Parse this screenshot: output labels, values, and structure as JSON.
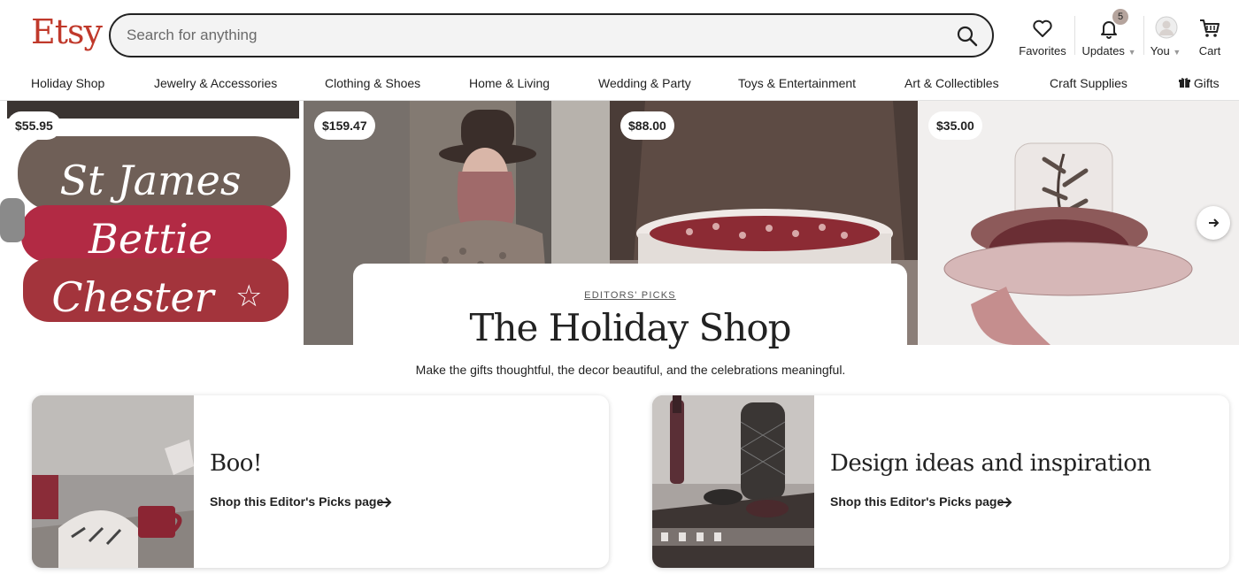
{
  "header": {
    "logo": "Etsy",
    "search_placeholder": "Search for anything",
    "favorites_label": "Favorites",
    "updates_label": "Updates",
    "updates_count": "5",
    "you_label": "You",
    "cart_label": "Cart"
  },
  "categories": [
    "Holiday Shop",
    "Jewelry & Accessories",
    "Clothing & Shoes",
    "Home & Living",
    "Wedding & Party",
    "Toys & Entertainment",
    "Art & Collectibles",
    "Craft Supplies",
    "Gifts"
  ],
  "hero": {
    "prices": [
      "$55.95",
      "$159.47",
      "$88.00",
      "$35.00"
    ],
    "collar_names": [
      "St James",
      "Bettie",
      "Chester"
    ],
    "eyebrow": "EDITORS' PICKS",
    "title": "The Holiday Shop",
    "subtitle": "Make the gifts thoughtful, the decor beautiful, and the celebrations meaningful."
  },
  "picks": [
    {
      "title": "Boo!",
      "link": "Shop this Editor's Picks page"
    },
    {
      "title": "Design ideas and inspiration",
      "link": "Shop this Editor's Picks page"
    }
  ],
  "colors": {
    "brand": "#c0392b",
    "text": "#222222",
    "divider": "#e1e1e1"
  }
}
